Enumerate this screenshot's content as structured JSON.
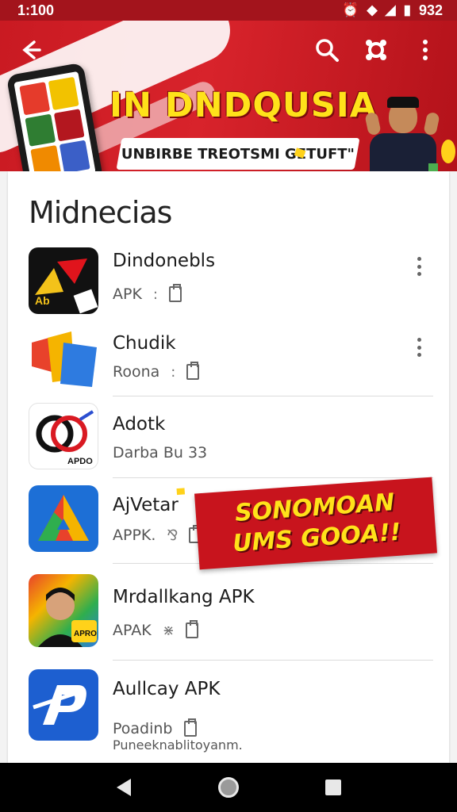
{
  "status_bar": {
    "time": "1:100",
    "battery": "932",
    "icons": [
      "alarm-icon",
      "wifi-icon",
      "signal-icon",
      "battery-icon"
    ]
  },
  "app_bar": {
    "icons": [
      "back-arrow-icon",
      "search-icon",
      "share-icon",
      "overflow-menu-icon"
    ]
  },
  "hero": {
    "title": "IN DNDQUSIA",
    "subtitle": "UNBIRBE TREOTSMI GETUFT\""
  },
  "section": {
    "title": "Midnecias"
  },
  "apps": [
    {
      "name": "Dindonebls",
      "meta": "APK",
      "sep": ":",
      "has_menu": true
    },
    {
      "name": "Chudik",
      "meta": "Roona",
      "sep": ":",
      "has_menu": true
    },
    {
      "name": "Adotk",
      "meta": "Darba Bu 33",
      "sep": "",
      "has_menu": false
    },
    {
      "name": "AjVetar",
      "meta": "APPK.",
      "sep": "⅋",
      "has_menu": false
    },
    {
      "name": "Mrdallkang APK",
      "meta": "APAK",
      "sep": "⋇",
      "has_menu": false
    },
    {
      "name": "Aullcay APK",
      "meta": "Poadinb",
      "meta2": "Puneeknablitoyanm.",
      "sep": "",
      "has_menu": false
    }
  ],
  "app_icon_labels": {
    "app1": "Ab",
    "app3": "APDO",
    "app5": "APRO"
  },
  "promo": {
    "line1": "SONOMOAN",
    "line2": "UMS GOOA!!"
  },
  "colors": {
    "brand_red": "#c91a22",
    "accent_yellow": "#ffe21a",
    "nav_bg": "#000000"
  }
}
